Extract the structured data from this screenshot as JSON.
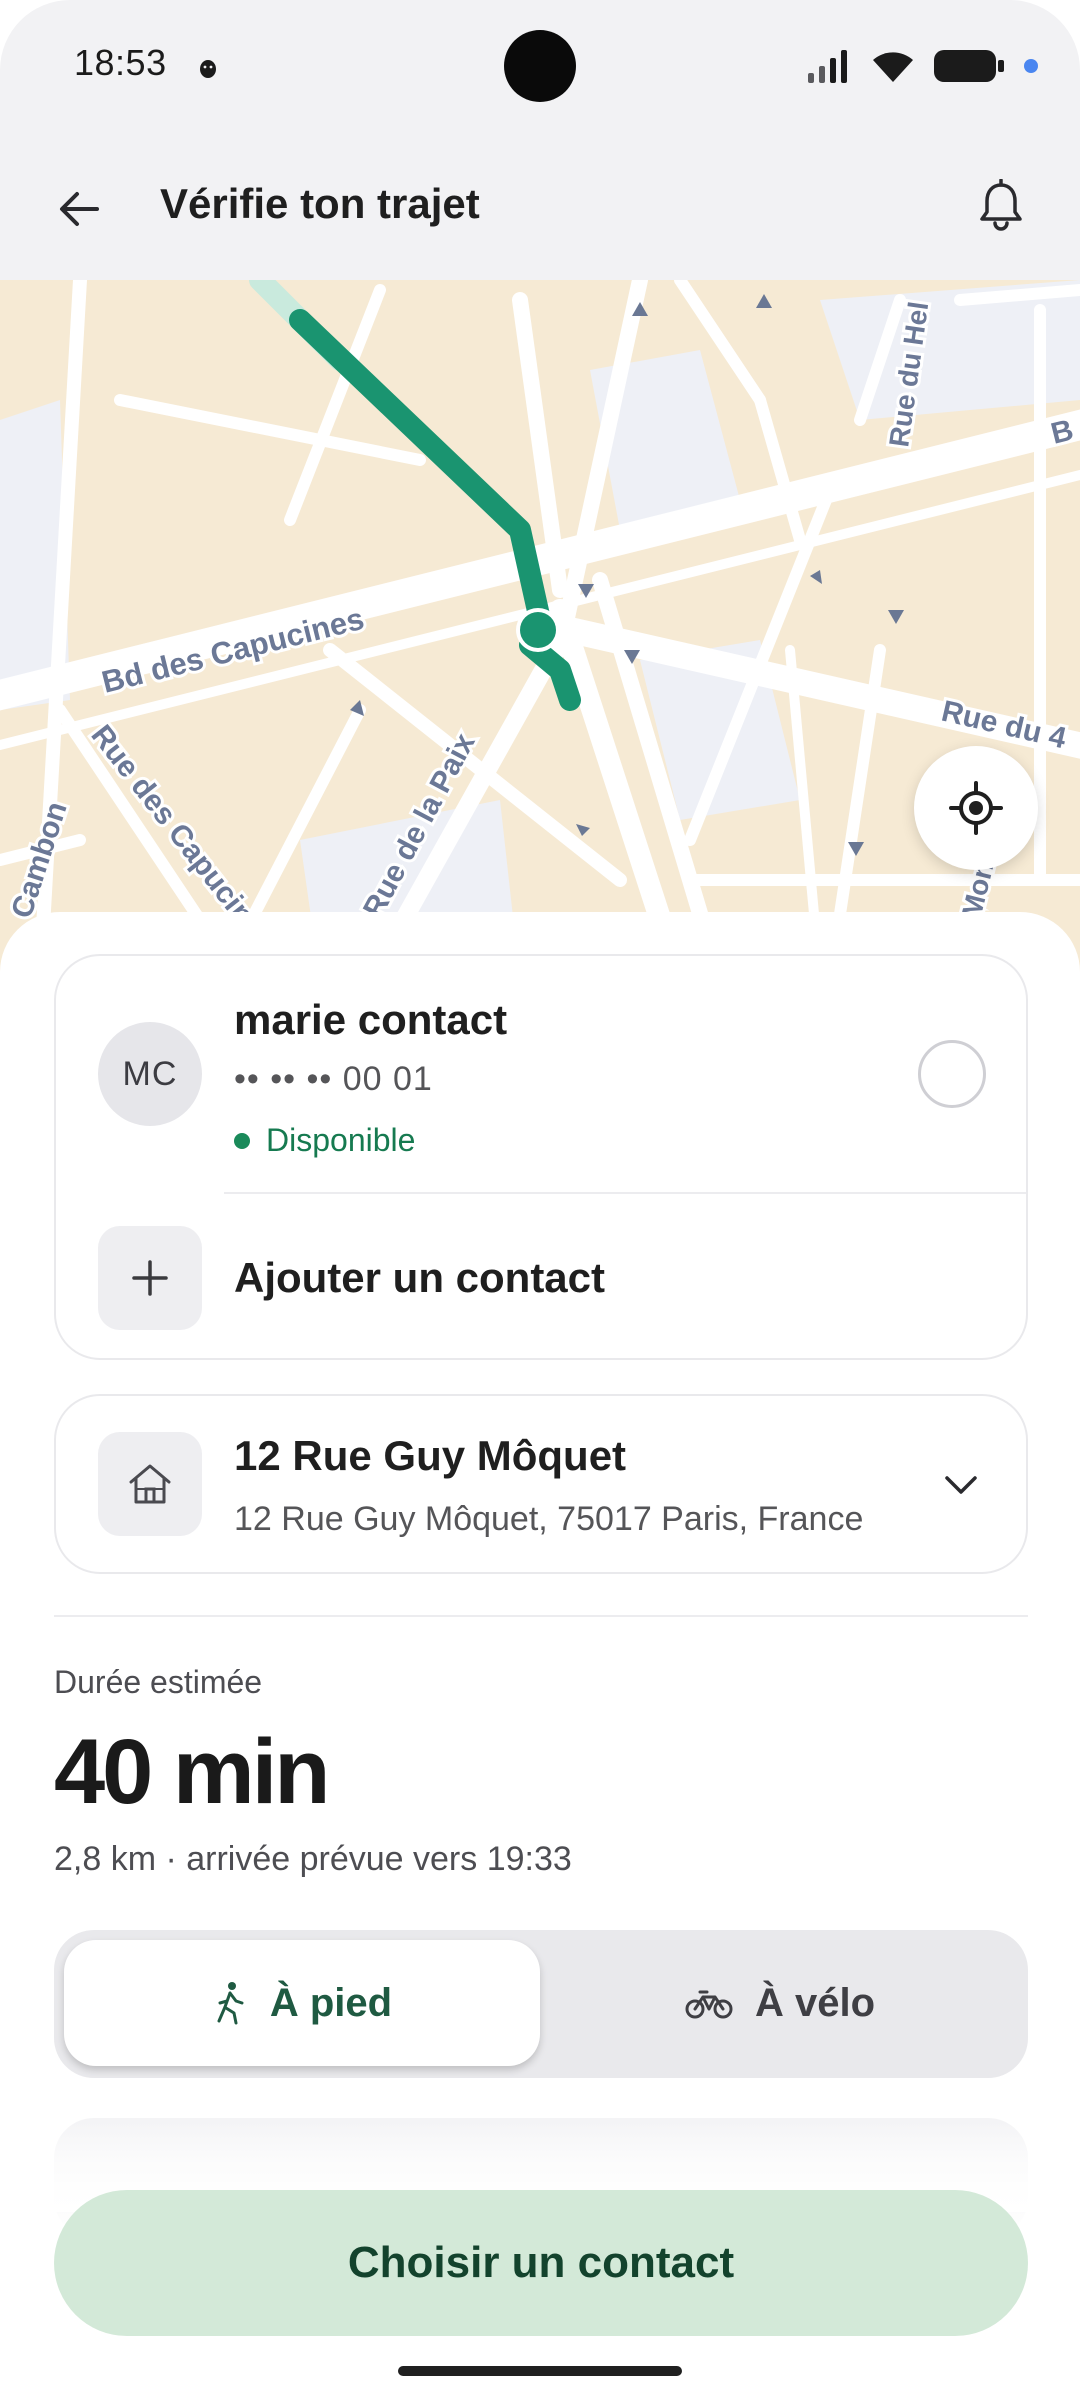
{
  "status_bar": {
    "time": "18:53",
    "icons": [
      "android-debug-icon",
      "signal-icon",
      "wifi-icon",
      "battery-icon",
      "dot-icon"
    ]
  },
  "header": {
    "title": "Vérifie ton trajet",
    "back_icon": "arrow-left-icon",
    "notification_icon": "bell-icon"
  },
  "map": {
    "street_labels": [
      "Bd des Capucines",
      "Rue des Capucines",
      "Rue de la Paix",
      "Rue du 4",
      "Rue du Hel",
      "Cambon",
      "Mon",
      "B"
    ],
    "route_color": "#1a9470",
    "locate_icon": "crosshair-icon"
  },
  "contact_card": {
    "avatar_initials": "MC",
    "name": "marie contact",
    "phone": "•• •• •• 00 01",
    "status": "Disponible",
    "status_color": "#1a8a5a",
    "add_label": "Ajouter un contact",
    "add_icon": "plus-icon"
  },
  "destination": {
    "title": "12 Rue Guy Môquet",
    "subtitle": "12 Rue Guy Môquet, 75017 Paris, France",
    "icon": "home-icon",
    "expand_icon": "chevron-down-icon"
  },
  "trip": {
    "duration_label": "Durée estimée",
    "duration_value": "40 min",
    "details": "2,8 km · arrivée prévue vers 19:33"
  },
  "modes": {
    "walk_label": "À pied",
    "bike_label": "À vélo",
    "selected": "walk"
  },
  "cta": {
    "label": "Choisir un contact",
    "color": "#d3e9d8"
  }
}
